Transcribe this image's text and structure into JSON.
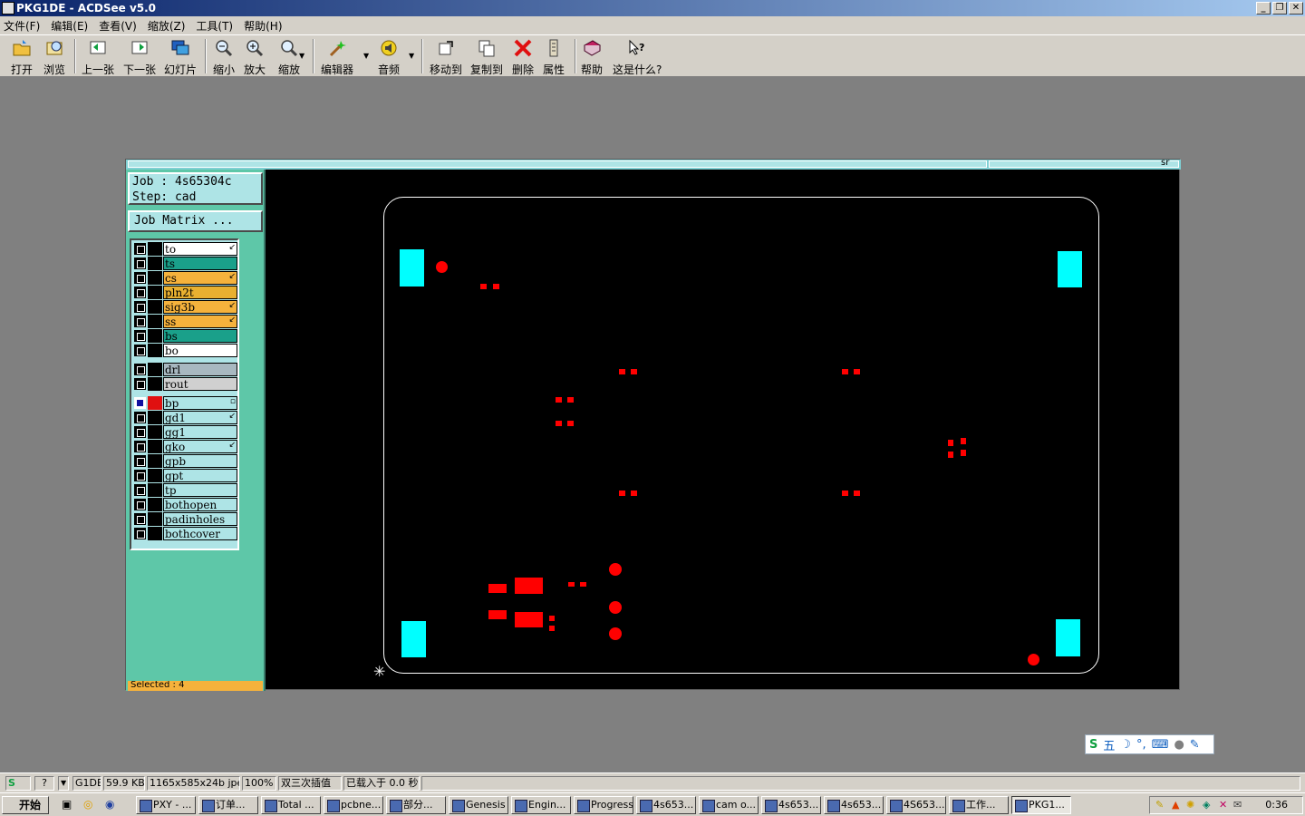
{
  "window": {
    "title": "PKG1DE - ACDSee v5.0",
    "buttons": [
      "_",
      "❐",
      "✕"
    ]
  },
  "menu": [
    "文件(F)",
    "编辑(E)",
    "查看(V)",
    "缩放(Z)",
    "工具(T)",
    "帮助(H)"
  ],
  "toolbar": {
    "open": "打开",
    "browse": "浏览",
    "prev": "上一张",
    "next": "下一张",
    "slideshow": "幻灯片",
    "zoom_out": "缩小",
    "zoom_in": "放大",
    "zoom": "缩放",
    "editor": "编辑器",
    "audio": "音频",
    "move_to": "移动到",
    "copy_to": "复制到",
    "delete": "删除",
    "properties": "属性",
    "help": "帮助",
    "whats_this": "这是什么?"
  },
  "genesis": {
    "job": "Job : 4s65304c",
    "step": "Step: cad",
    "matrix_button": "Job Matrix ...",
    "selected": "Selected : 4",
    "corner_label": "sr",
    "layers": [
      {
        "name": "to",
        "color": "#ffffff",
        "mark": "↙"
      },
      {
        "name": "ts",
        "color": "#1aa08a",
        "mark": ""
      },
      {
        "name": "cs",
        "color": "#f5b23c",
        "mark": "↙"
      },
      {
        "name": "pln2t",
        "color": "#e8b030",
        "mark": ""
      },
      {
        "name": "sig3b",
        "color": "#f5b23c",
        "mark": "↙"
      },
      {
        "name": "ss",
        "color": "#f5b23c",
        "mark": "↙"
      },
      {
        "name": "bs",
        "color": "#1aa08a",
        "mark": ""
      },
      {
        "name": "bo",
        "color": "#ffffff",
        "mark": ""
      },
      {
        "name": "drl",
        "color": "#a8b8c0",
        "mark": ""
      },
      {
        "name": "rout",
        "color": "#d0d0d0",
        "mark": ""
      },
      {
        "name": "bp",
        "color": "#aee4e6",
        "mark": "▫",
        "selected": true
      },
      {
        "name": "gd1",
        "color": "#aee4e6",
        "mark": "↙"
      },
      {
        "name": "gg1",
        "color": "#aee4e6",
        "mark": ""
      },
      {
        "name": "gko",
        "color": "#aee4e6",
        "mark": "↙"
      },
      {
        "name": "gpb",
        "color": "#aee4e6",
        "mark": ""
      },
      {
        "name": "gpt",
        "color": "#aee4e6",
        "mark": ""
      },
      {
        "name": "tp",
        "color": "#aee4e6",
        "mark": ""
      },
      {
        "name": "bothopen",
        "color": "#aee4e6",
        "mark": ""
      },
      {
        "name": "padinholes",
        "color": "#aee4e6",
        "mark": ""
      },
      {
        "name": "bothcover",
        "color": "#aee4e6",
        "mark": ""
      }
    ]
  },
  "ime": {
    "label": "五"
  },
  "statusbar": [
    "G1DE",
    "59.9 KB",
    "1165x585x24b jpeg",
    "100%",
    "双三次插值",
    "已载入于 0.0 秒"
  ],
  "taskbar": {
    "start": "开始",
    "items": [
      "PXY - ...",
      "订单...",
      "Total ...",
      "pcbne...",
      "部分...",
      "Genesis",
      "Engin...",
      "Progress",
      "4s653...",
      "cam o...",
      "4s653...",
      "4s653...",
      "4S653...",
      "工作...",
      "PKG1..."
    ],
    "clock": "0:36"
  },
  "colors": {
    "accent": "#0a246a",
    "panel": "#5ec7a8",
    "cyan_pad": "#00ffff",
    "red_pad": "#ff0000"
  }
}
